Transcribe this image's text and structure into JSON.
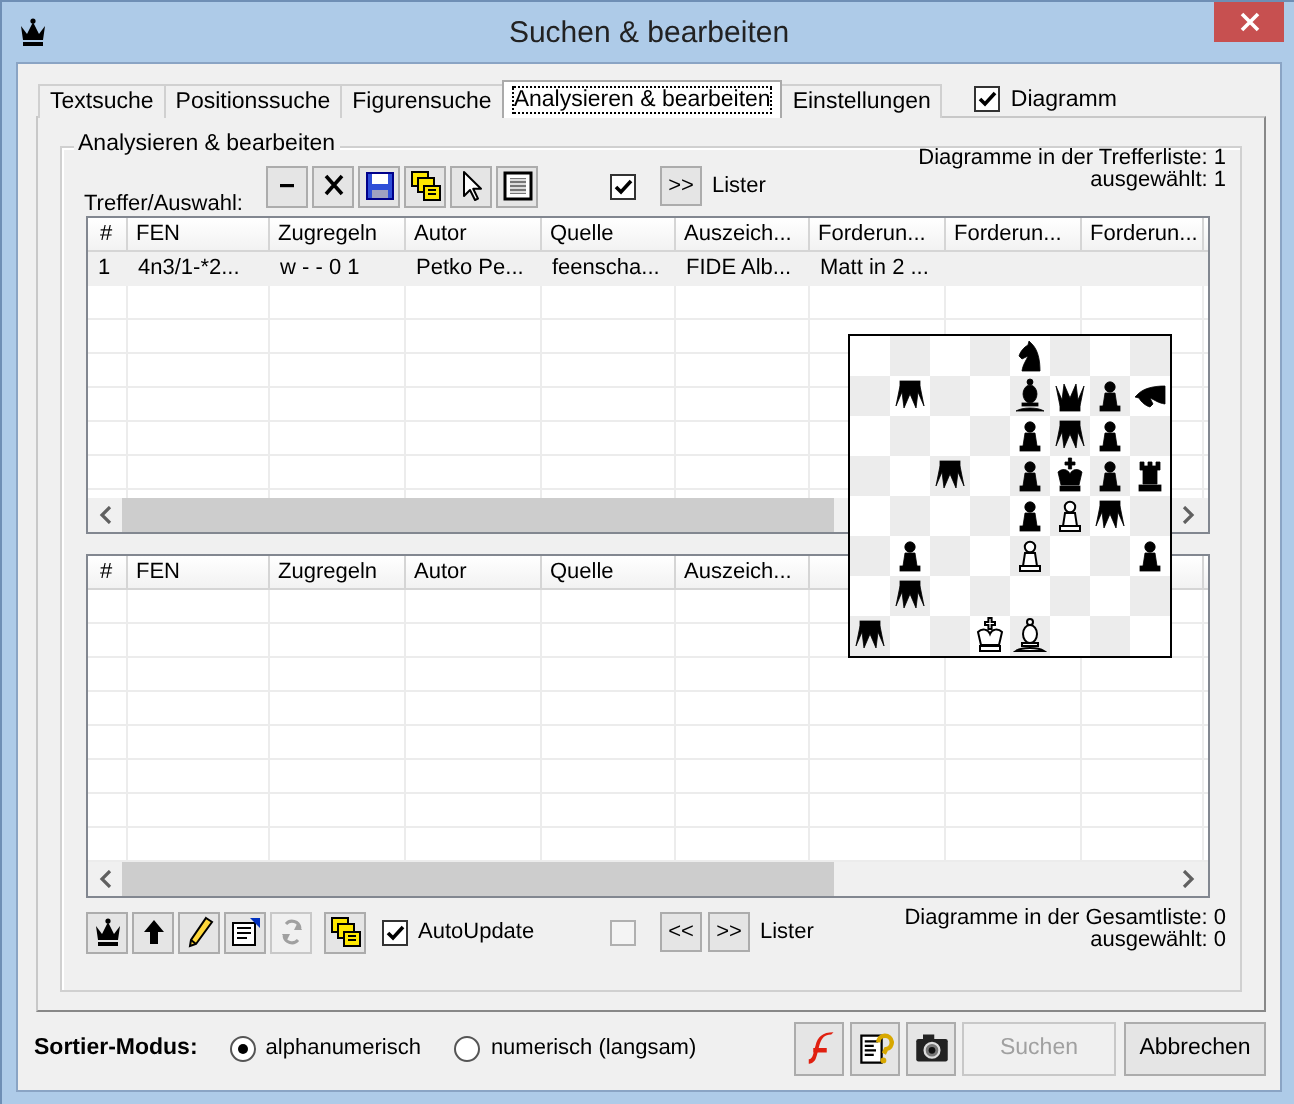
{
  "window": {
    "title": "Suchen & bearbeiten"
  },
  "tabs": [
    {
      "label": "Textsuche",
      "selected": false
    },
    {
      "label": "Positionssuche",
      "selected": false
    },
    {
      "label": "Figurensuche",
      "selected": false
    },
    {
      "label": "Analysieren & bearbeiten",
      "selected": true
    },
    {
      "label": "Einstellungen",
      "selected": false
    }
  ],
  "diagram_checkbox": {
    "label": "Diagramm",
    "checked": true
  },
  "group": {
    "title": "Analysieren & bearbeiten"
  },
  "hits_toolbar": {
    "label": "Treffer/Auswahl:",
    "buttons": [
      {
        "kind": "remove",
        "disabled": false
      },
      {
        "kind": "delete",
        "disabled": false
      },
      {
        "kind": "save",
        "disabled": false
      },
      {
        "kind": "copy",
        "disabled": false
      },
      {
        "kind": "pointer",
        "disabled": false
      },
      {
        "kind": "diagram",
        "disabled": false
      }
    ],
    "checkbox": {
      "checked": true,
      "disabled": false
    },
    "nav_buttons": [
      ">>"
    ],
    "lister_label": "Lister",
    "counts": [
      "Diagramme in der Trefferliste: 1",
      "ausgewählt: 1"
    ]
  },
  "hits_table": {
    "columns": [
      "#",
      "FEN",
      "Zugregeln",
      "Autor",
      "Quelle",
      "Auszeich...",
      "Forderun...",
      "Forderun...",
      "Forderun..."
    ],
    "rows": [
      {
        "selected": true,
        "cells": [
          "1",
          "4n3/1-*2...",
          "w - - 0 1",
          "Petko Pe...",
          "feenscha...",
          "FIDE Alb...",
          "Matt in 2 ...",
          "",
          ""
        ]
      }
    ]
  },
  "board": {
    "rows": [
      {
        "squares": [
          {
            "kind": "empty"
          },
          {
            "kind": "empty"
          },
          {
            "kind": "empty"
          },
          {
            "kind": "empty"
          },
          {
            "kind": "black-knight"
          },
          {
            "kind": "empty"
          },
          {
            "kind": "empty"
          },
          {
            "kind": "empty"
          }
        ]
      },
      {
        "squares": [
          {
            "kind": "empty"
          },
          {
            "kind": "black-grasshopper"
          },
          {
            "kind": "empty"
          },
          {
            "kind": "empty"
          },
          {
            "kind": "black-bishop"
          },
          {
            "kind": "black-queen"
          },
          {
            "kind": "black-pawn"
          },
          {
            "kind": "black-rotatedknight"
          }
        ]
      },
      {
        "squares": [
          {
            "kind": "empty"
          },
          {
            "kind": "empty"
          },
          {
            "kind": "empty"
          },
          {
            "kind": "empty"
          },
          {
            "kind": "black-pawn"
          },
          {
            "kind": "black-grasshopper"
          },
          {
            "kind": "black-pawn"
          },
          {
            "kind": "empty"
          }
        ]
      },
      {
        "squares": [
          {
            "kind": "empty"
          },
          {
            "kind": "empty"
          },
          {
            "kind": "black-grasshopper"
          },
          {
            "kind": "empty"
          },
          {
            "kind": "black-pawn"
          },
          {
            "kind": "black-king"
          },
          {
            "kind": "black-pawn"
          },
          {
            "kind": "black-rook"
          }
        ]
      },
      {
        "squares": [
          {
            "kind": "empty"
          },
          {
            "kind": "empty"
          },
          {
            "kind": "empty"
          },
          {
            "kind": "empty"
          },
          {
            "kind": "black-pawn"
          },
          {
            "kind": "white-pawn"
          },
          {
            "kind": "black-grasshopper"
          },
          {
            "kind": "empty"
          }
        ]
      },
      {
        "squares": [
          {
            "kind": "empty"
          },
          {
            "kind": "black-pawn"
          },
          {
            "kind": "empty"
          },
          {
            "kind": "empty"
          },
          {
            "kind": "white-pawn"
          },
          {
            "kind": "empty"
          },
          {
            "kind": "empty"
          },
          {
            "kind": "black-pawn"
          }
        ]
      },
      {
        "squares": [
          {
            "kind": "empty"
          },
          {
            "kind": "black-grasshopper"
          },
          {
            "kind": "empty"
          },
          {
            "kind": "empty"
          },
          {
            "kind": "empty"
          },
          {
            "kind": "empty"
          },
          {
            "kind": "empty"
          },
          {
            "kind": "empty"
          }
        ]
      },
      {
        "squares": [
          {
            "kind": "black-grasshopper"
          },
          {
            "kind": "empty"
          },
          {
            "kind": "empty"
          },
          {
            "kind": "white-king"
          },
          {
            "kind": "white-bishop"
          },
          {
            "kind": "empty"
          },
          {
            "kind": "empty"
          },
          {
            "kind": "empty"
          }
        ]
      }
    ]
  },
  "all_table": {
    "columns": [
      "#",
      "FEN",
      "Zugregeln",
      "Autor",
      "Quelle",
      "Auszeich..."
    ]
  },
  "all_toolbar": {
    "buttons": [
      {
        "kind": "crown",
        "disabled": false
      },
      {
        "kind": "up",
        "disabled": false
      },
      {
        "kind": "edit",
        "disabled": false
      },
      {
        "kind": "properties",
        "disabled": false
      },
      {
        "kind": "refresh",
        "disabled": true
      },
      {
        "kind": "copy",
        "disabled": false
      }
    ],
    "autoupdate": {
      "label": "AutoUpdate",
      "checked": true
    },
    "checkbox": {
      "checked": false,
      "disabled": true
    },
    "nav_buttons": [
      "<<",
      ">>"
    ],
    "lister_label": "Lister",
    "counts": [
      "Diagramme in der Gesamtliste: 0",
      "ausgewählt: 0"
    ]
  },
  "footer": {
    "sort_label": "Sortier-Modus:",
    "sort_options": [
      {
        "label": "alphanumerisch",
        "selected": true
      },
      {
        "label": "numerisch (langsam)",
        "selected": false
      }
    ],
    "icon_buttons": [
      {
        "kind": "flash"
      },
      {
        "kind": "help"
      },
      {
        "kind": "camera"
      }
    ],
    "buttons": [
      {
        "label": "Suchen",
        "disabled": true
      },
      {
        "label": "Abbrechen",
        "disabled": false
      }
    ]
  }
}
